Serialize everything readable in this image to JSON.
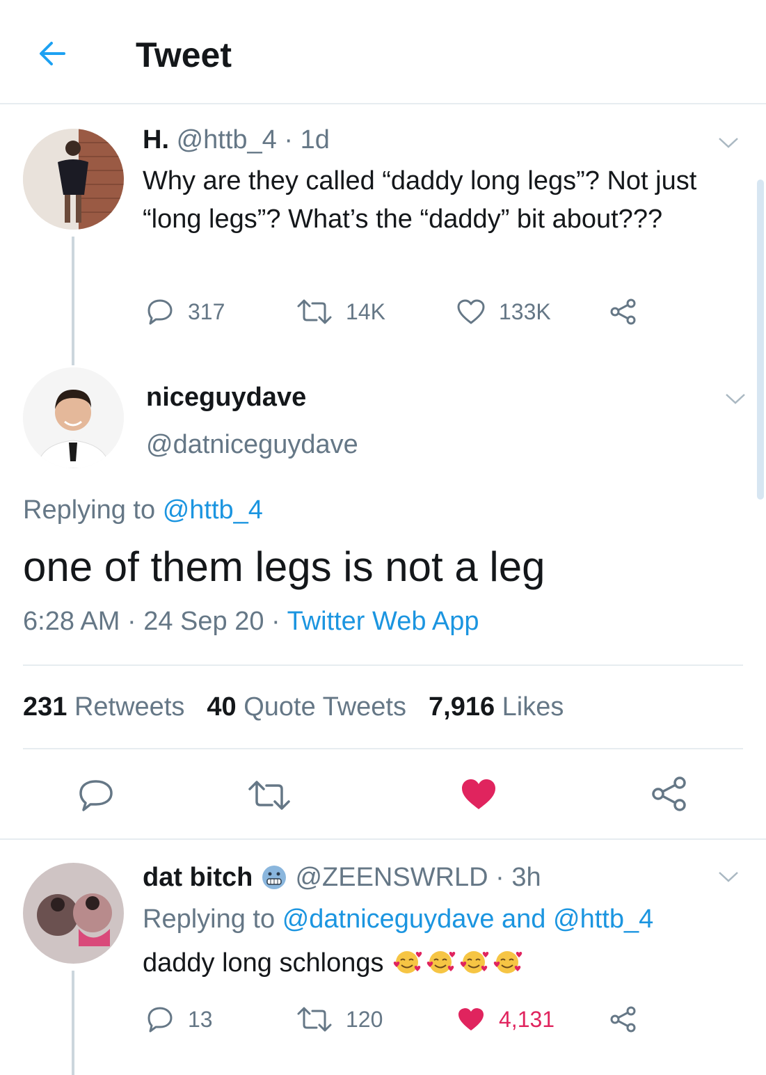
{
  "header": {
    "title": "Tweet",
    "back_icon": "arrow-left-icon",
    "accent": "#1da1f2"
  },
  "original_tweet": {
    "name": "H.",
    "handle": "@httb_4",
    "time": "1d",
    "text": "Why are they called “daddy long legs”? Not just “long legs”? What’s the “daddy” bit about???",
    "replies": "317",
    "retweets": "14K",
    "likes": "133K"
  },
  "main_tweet": {
    "name": "niceguydave",
    "handle": "@datniceguydave",
    "replying_prefix": "Replying to",
    "replying_to": "@httb_4",
    "text": "one of them legs is not a leg",
    "time": "6:28 AM",
    "date": "24 Sep 20",
    "source": "Twitter Web App",
    "retweets_count": "231",
    "retweets_label": "Retweets",
    "quotes_count": "40",
    "quotes_label": "Quote Tweets",
    "likes_count": "7,916",
    "likes_label": "Likes",
    "like_color": "#e0245e"
  },
  "reply_tweet": {
    "name": "dat bitch",
    "badge_emoji": "grimacing-face-icon",
    "handle": "@ZEENSWRLD",
    "time": "3h",
    "replying_prefix": "Replying to",
    "replying_to_1": "@datniceguydave",
    "replying_and": "and",
    "replying_to_2": "@httb_4",
    "text": "daddy long schlongs",
    "emojis": [
      "smiling-face-with-hearts-icon",
      "smiling-face-with-hearts-icon",
      "smiling-face-with-hearts-icon",
      "smiling-face-with-hearts-icon"
    ],
    "replies": "13",
    "retweets": "120",
    "likes": "4,131"
  }
}
